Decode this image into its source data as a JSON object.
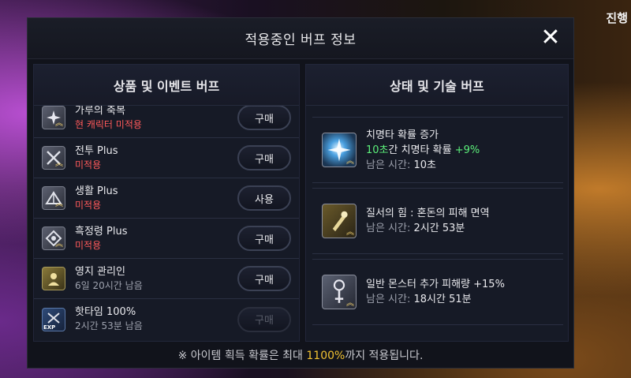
{
  "background": {
    "corner_label": "진행"
  },
  "modal": {
    "title": "적용중인 버프 정보",
    "close_label": "✕"
  },
  "left_panel": {
    "title": "상품 및 이벤트 버프",
    "items": [
      {
        "name": "가루의 축복",
        "status": "현 캐릭터 미적용",
        "status_color": "red",
        "button": "구매",
        "icon": "blessing-icon"
      },
      {
        "name": "전투 Plus",
        "status": "미적용",
        "status_color": "red",
        "button": "구매",
        "icon": "combat-swords-icon"
      },
      {
        "name": "생활 Plus",
        "status": "미적용",
        "status_color": "red",
        "button": "사용",
        "icon": "life-tent-icon"
      },
      {
        "name": "흑정령 Plus",
        "status": "미적용",
        "status_color": "red",
        "button": "구매",
        "icon": "black-spirit-icon"
      },
      {
        "name": "영지 관리인",
        "status": "6일 20시간 남음",
        "status_color": "gray",
        "button": "구매",
        "icon": "territory-manager-icon"
      },
      {
        "name": "핫타임 100%",
        "status": "2시간 53분 남음",
        "status_color": "gray",
        "button": "구매",
        "icon": "exp-hottime-icon",
        "icon_text": "EXP"
      }
    ]
  },
  "right_panel": {
    "title": "상태 및 기술 버프",
    "time_prefix": "남은 시간:",
    "buffs": [
      {
        "name": "치명타 확률 증가",
        "desc_highlight": "10초",
        "desc_mid": "간 치명타 확률 ",
        "desc_bonus": "+9%",
        "time": "10초",
        "icon": "critical-burst-icon"
      },
      {
        "name": "질서의 힘 : 혼돈의 피해 면역",
        "time": "2시간 53분",
        "icon": "order-power-icon"
      },
      {
        "name": "일반 몬스터 추가 피해량 +15%",
        "time": "18시간 51분",
        "icon": "monster-damage-icon"
      }
    ]
  },
  "footer": {
    "prefix": "※ 아이템 획득 확률은 최대 ",
    "highlight": "1100%",
    "suffix": "까지 적용됩니다."
  }
}
